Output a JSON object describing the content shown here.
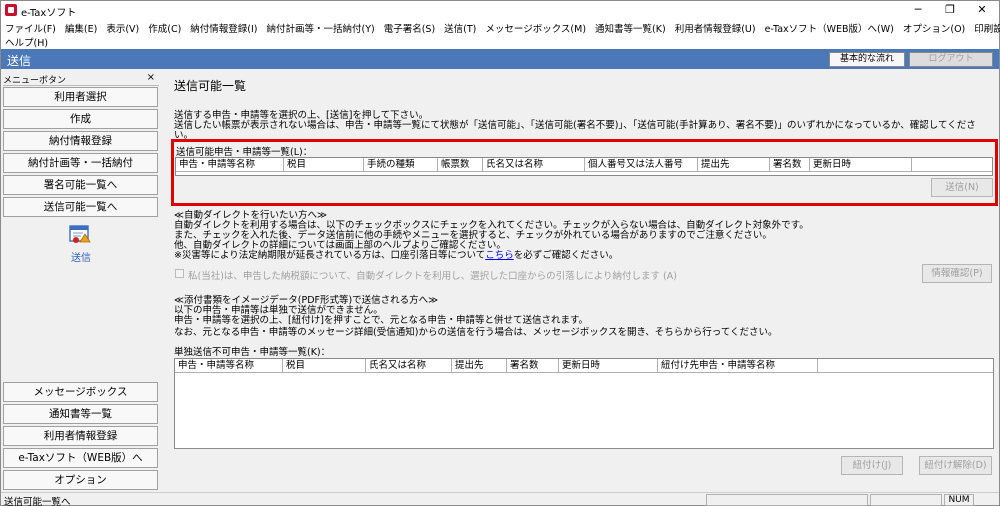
{
  "window": {
    "title": "e-Taxソフト",
    "controls": [
      "─",
      "❐",
      "✕"
    ]
  },
  "menu": {
    "row1": [
      "ファイル(F)",
      "編集(E)",
      "表示(V)",
      "作成(C)",
      "納付情報登録(I)",
      "納付計画等・一括納付(Y)",
      "電子署名(S)",
      "送信(T)",
      "メッセージボックス(M)",
      "通知書等一覧(K)",
      "利用者情報登録(U)",
      "e-Taxソフト（WEB版）へ(W)",
      "オプション(O)",
      "印刷設定(Q)"
    ],
    "row2": [
      "ヘルプ(H)"
    ]
  },
  "header": {
    "title": "送信",
    "basic_flow": "基本的な流れ",
    "logout": "ログアウト"
  },
  "sidebar": {
    "title": "メニューボタン",
    "close": "×",
    "top_items": [
      "利用者選択",
      "作成",
      "納付情報登録",
      "納付計画等・一括納付",
      "署名可能一覧へ",
      "送信可能一覧へ"
    ],
    "icon_label": "送信",
    "bottom_items": [
      "メッセージボックス",
      "通知書等一覧",
      "利用者情報登録",
      "e-Taxソフト（WEB版）へ",
      "オプション"
    ]
  },
  "main": {
    "page_title": "送信可能一覧",
    "intro_1": "送信する申告・申請等を選択の上、[送信]を押して下さい。",
    "intro_2": "送信したい帳票が表示されない場合は、申告・申請等一覧にて状態が「送信可能」、「送信可能(署名不要)」、「送信可能(手計算あり、署名不要)」のいずれかになっているか、確認してくださ",
    "intro_3": "い。",
    "sendable_label": "送信可能申告・申請等一覧(L)：",
    "sendable_columns": [
      "申告・申請等名称",
      "税目",
      "手続の種類",
      "帳票数",
      "氏名又は名称",
      "個人番号又は法人番号",
      "提出先",
      "署名数",
      "更新日時"
    ],
    "send_button": "送信(N)",
    "direct_title": "≪自動ダイレクトを行いたい方へ≫",
    "direct_1": "自動ダイレクトを利用する場合は、以下のチェックボックスにチェックを入れてください。チェックが入らない場合は、自動ダイレクト対象外です。",
    "direct_2": "また、チェックを入れた後、データ送信前に他の手続やメニューを選択すると、チェックが外れている場合がありますのでご注意ください。",
    "direct_3": "他、自動ダイレクトの詳細については画面上部のヘルプよりご確認ください。",
    "direct_4a": "※災害等により法定納期限が延長されている方は、口座引落日等について",
    "direct_4_link": "こちら",
    "direct_4b": "を必ずご確認ください。",
    "checkbox_label": "私(当社)は、申告した納税額について、自動ダイレクトを利用し、選択した口座からの引落しにより納付します (A)",
    "info_button": "情報確認(P)",
    "attach_title": "≪添付書類をイメージデータ(PDF形式等)で送信される方へ≫",
    "attach_1": "以下の申告・申請等は単独で送信ができません。",
    "attach_2": "申告・申請等を選択の上、[紐付け]を押すことで、元となる申告・申請等と併せて送信されます。",
    "attach_3": "なお、元となる申告・申請等のメッセージ詳細(受信通知)からの送信を行う場合は、メッセージボックスを開き、そちらから行ってください。",
    "single_label": "単独送信不可申告・申請等一覧(K)：",
    "single_columns": [
      "申告・申請等名称",
      "税目",
      "氏名又は名称",
      "提出先",
      "署名数",
      "更新日時",
      "紐付け先申告・申請等名称"
    ],
    "link_button": "紐付け(J)",
    "unlink_button": "紐付け解除(D)"
  },
  "status": {
    "text": "送信可能一覧へ",
    "num": "NUM"
  }
}
